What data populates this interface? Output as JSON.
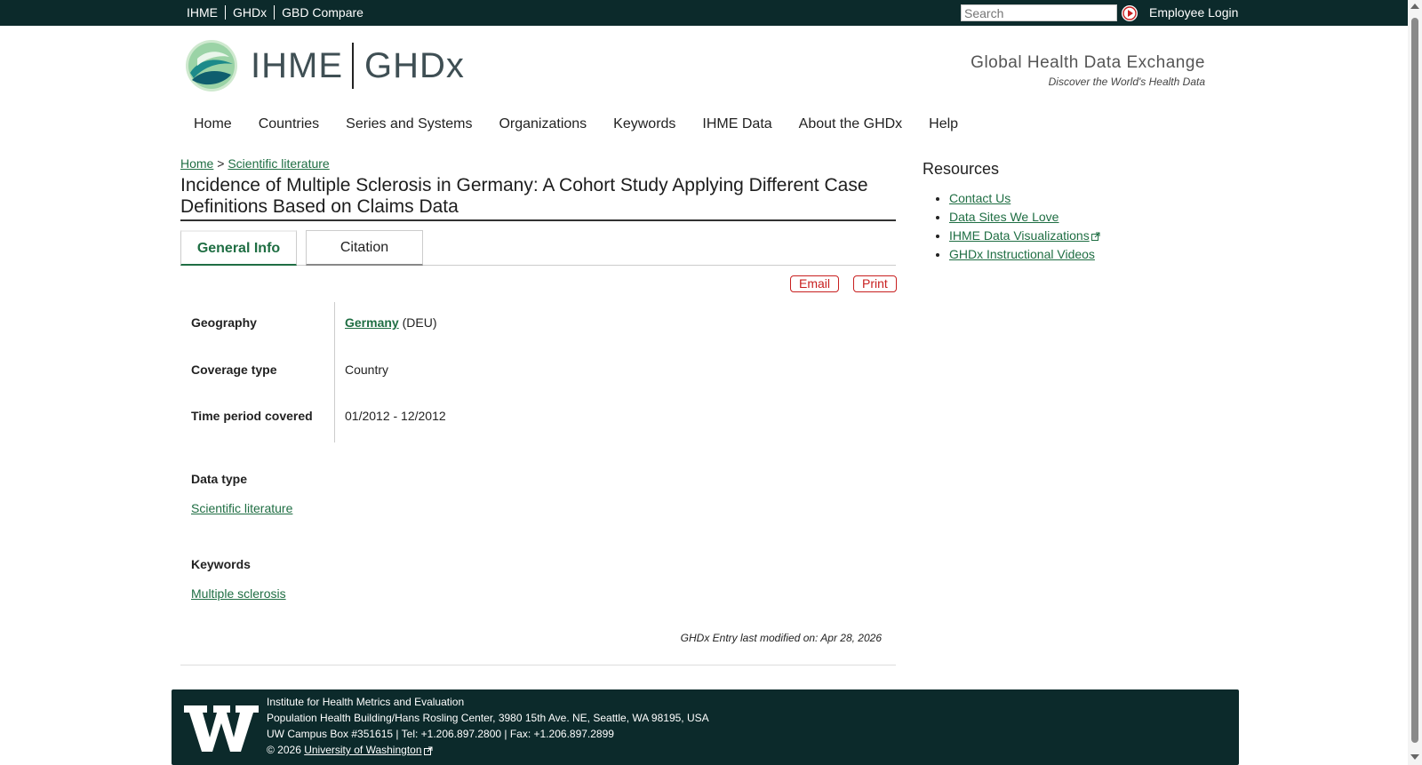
{
  "topbar": {
    "links": [
      "IHME",
      "GHDx",
      "GBD Compare"
    ],
    "search_placeholder": "Search",
    "employee_login": "Employee Login"
  },
  "header": {
    "brand_left": "IHME",
    "brand_right": "GHDx",
    "tagline": "Global Health Data Exchange",
    "subtagline": "Discover the World's Health Data"
  },
  "nav": [
    "Home",
    "Countries",
    "Series and Systems",
    "Organizations",
    "Keywords",
    "IHME Data",
    "About the GHDx",
    "Help"
  ],
  "breadcrumb": {
    "home": "Home",
    "sep": ">",
    "section": "Scientific literature"
  },
  "page": {
    "title": "Incidence of Multiple Sclerosis in Germany: A Cohort Study Applying Different Case Definitions Based on Claims Data",
    "tabs": [
      "General Info",
      "Citation"
    ],
    "actions": {
      "email": "Email",
      "print": "Print"
    },
    "fields": {
      "geography_label": "Geography",
      "geography_link": "Germany",
      "geography_code": "(DEU)",
      "coverage_label": "Coverage type",
      "coverage_value": "Country",
      "period_label": "Time period covered",
      "period_value": "01/2012 - 12/2012",
      "datatype_label": "Data type",
      "datatype_link": "Scientific literature",
      "keywords_label": "Keywords",
      "keywords_link": "Multiple sclerosis"
    },
    "modified": "GHDx Entry last modified on: Apr 28, 2026"
  },
  "sidebar": {
    "title": "Resources",
    "links": [
      "Contact Us",
      "Data Sites We Love",
      "IHME Data Visualizations",
      "GHDx Instructional Videos"
    ]
  },
  "footer": {
    "line1": "Institute for Health Metrics and Evaluation",
    "line2": "Population Health Building/Hans Rosling Center, 3980 15th Ave. NE, Seattle, WA 98195, USA",
    "line3": "UW Campus Box #351615 | Tel: +1.206.897.2800 | Fax: +1.206.897.2899",
    "copyright": "© 2026",
    "uw_link": "University of Washington"
  },
  "colors": {
    "dark": "#0c2a2b",
    "link": "#1f6e43",
    "alert": "#c81f1f"
  }
}
